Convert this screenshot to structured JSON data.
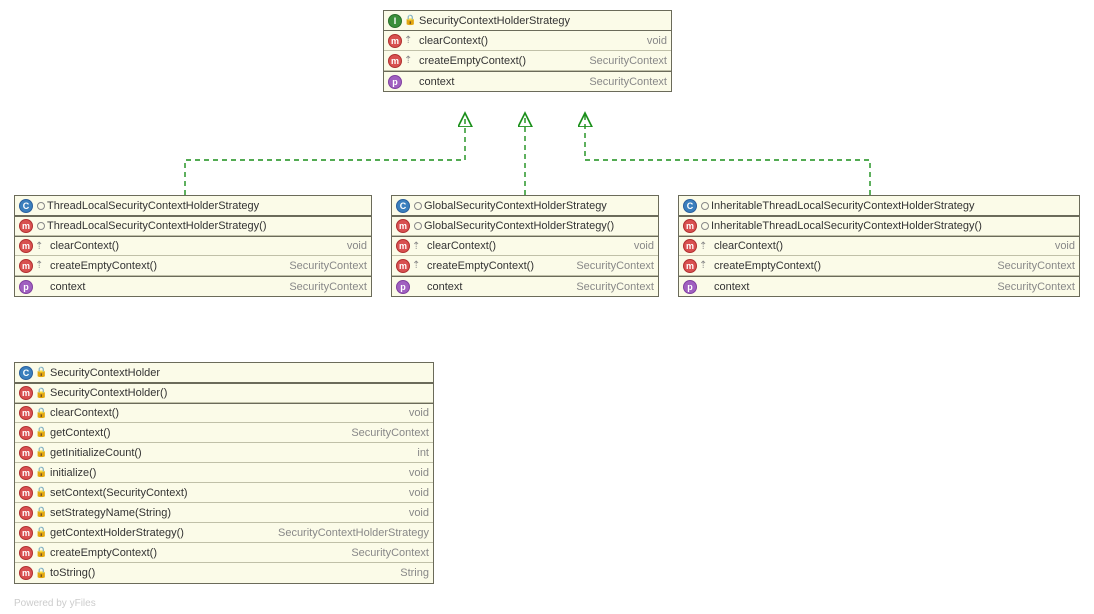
{
  "diagram": {
    "credit": "Powered by yFiles",
    "interface": {
      "name": "SecurityContextHolderStrategy",
      "methods": [
        {
          "name": "clearContext()",
          "ret": "void"
        },
        {
          "name": "createEmptyContext()",
          "ret": "SecurityContext"
        }
      ],
      "properties": [
        {
          "name": "context",
          "ret": "SecurityContext"
        }
      ]
    },
    "impls": [
      {
        "name": "ThreadLocalSecurityContextHolderStrategy",
        "ctor": "ThreadLocalSecurityContextHolderStrategy()",
        "methods": [
          {
            "name": "clearContext()",
            "ret": "void"
          },
          {
            "name": "createEmptyContext()",
            "ret": "SecurityContext"
          }
        ],
        "properties": [
          {
            "name": "context",
            "ret": "SecurityContext"
          }
        ]
      },
      {
        "name": "GlobalSecurityContextHolderStrategy",
        "ctor": "GlobalSecurityContextHolderStrategy()",
        "methods": [
          {
            "name": "clearContext()",
            "ret": "void"
          },
          {
            "name": "createEmptyContext()",
            "ret": "SecurityContext"
          }
        ],
        "properties": [
          {
            "name": "context",
            "ret": "SecurityContext"
          }
        ]
      },
      {
        "name": "InheritableThreadLocalSecurityContextHolderStrategy",
        "ctor": "InheritableThreadLocalSecurityContextHolderStrategy()",
        "methods": [
          {
            "name": "clearContext()",
            "ret": "void"
          },
          {
            "name": "createEmptyContext()",
            "ret": "SecurityContext"
          }
        ],
        "properties": [
          {
            "name": "context",
            "ret": "SecurityContext"
          }
        ]
      }
    ],
    "holder": {
      "name": "SecurityContextHolder",
      "ctor": "SecurityContextHolder()",
      "methods": [
        {
          "name": "clearContext()",
          "ret": "void"
        },
        {
          "name": "getContext()",
          "ret": "SecurityContext"
        },
        {
          "name": "getInitializeCount()",
          "ret": "int"
        },
        {
          "name": "initialize()",
          "ret": "void",
          "locked": true
        },
        {
          "name": "setContext(SecurityContext)",
          "ret": "void"
        },
        {
          "name": "setStrategyName(String)",
          "ret": "void"
        },
        {
          "name": "getContextHolderStrategy()",
          "ret": "SecurityContextHolderStrategy"
        },
        {
          "name": "createEmptyContext()",
          "ret": "SecurityContext"
        },
        {
          "name": "toString()",
          "ret": "String"
        }
      ]
    }
  }
}
